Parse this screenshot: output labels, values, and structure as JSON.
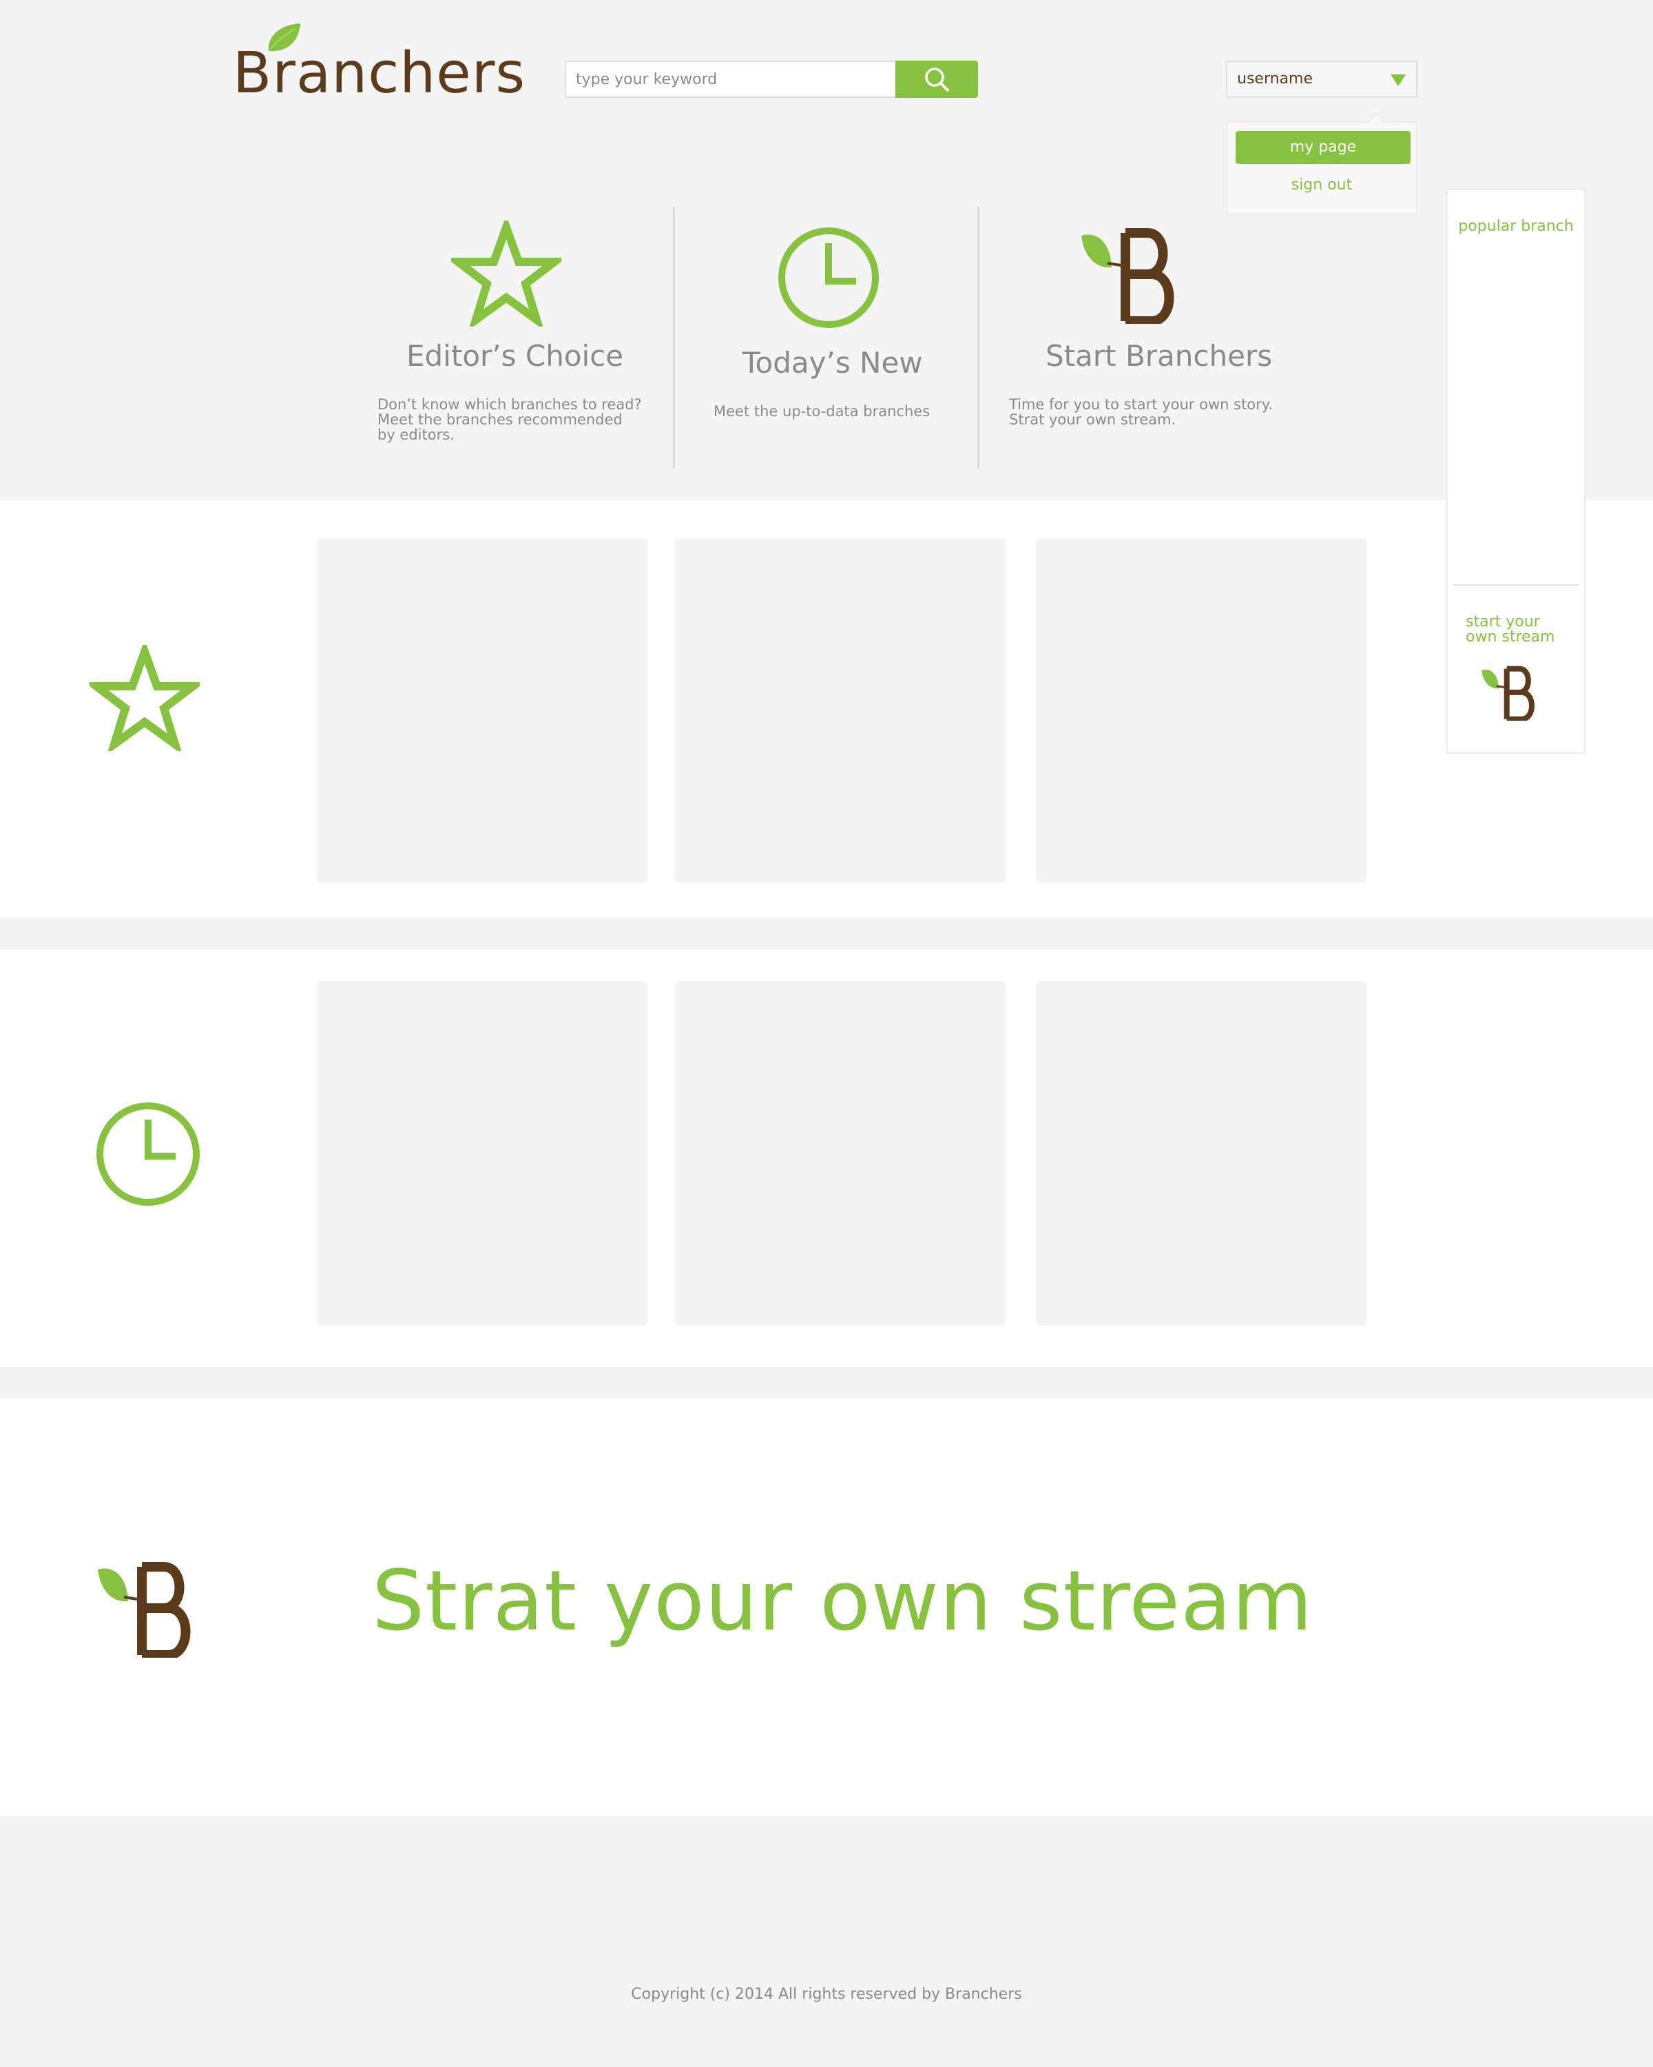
{
  "header": {
    "logo_text": "Branchers",
    "search_placeholder": "type your keyword",
    "username": "username",
    "menu": {
      "my_page": "my page",
      "sign_out": "sign out"
    }
  },
  "features": [
    {
      "title": "Editor’s Choice",
      "desc": [
        "Don’t know which branches to read?",
        "Meet the branches recommended",
        "by editors."
      ],
      "icon": "star-icon"
    },
    {
      "title": "Today’s New",
      "desc": [
        "Meet the up-to-data branches"
      ],
      "icon": "clock-icon"
    },
    {
      "title": "Start Branchers",
      "desc": [
        "Time for you to start your own story.",
        "Strat your own stream."
      ],
      "icon": "branchers-b-icon"
    }
  ],
  "sidebar": {
    "title": "popular branch",
    "start_line1": "start your",
    "start_line2": "own stream"
  },
  "cta": {
    "text": "Strat your own stream"
  },
  "footer": {
    "copyright": "Copyright (c) 2014 All rights reserved by Branchers"
  },
  "colors": {
    "green": "#86c240",
    "brown": "#5c3b1c",
    "grey_text": "#8a8a8a",
    "background": "#f4f4f4"
  }
}
